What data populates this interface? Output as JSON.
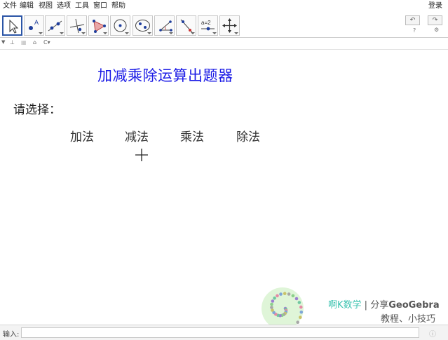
{
  "menu": {
    "items": [
      "文件",
      "编辑",
      "视图",
      "选项",
      "工具",
      "窗口",
      "帮助"
    ],
    "login": "登录"
  },
  "toolbar": {
    "tools": [
      {
        "icon": "move-arrow-icon",
        "active": true
      },
      {
        "icon": "point-icon",
        "label": "A"
      },
      {
        "icon": "line-icon"
      },
      {
        "icon": "perpendicular-line-icon"
      },
      {
        "icon": "polygon-icon"
      },
      {
        "icon": "circle-icon"
      },
      {
        "icon": "ellipse-icon"
      },
      {
        "icon": "angle-icon"
      },
      {
        "icon": "reflect-icon"
      },
      {
        "icon": "slider-icon",
        "label": "a=2"
      },
      {
        "icon": "move-view-icon"
      }
    ],
    "undo": "↶",
    "redo": "↷",
    "help_icon": "?",
    "settings_icon": "⚙"
  },
  "stylebar": {
    "axes_toggle": "⊥",
    "grid_toggle": "▦",
    "home": "⌂",
    "point_capture": "C▾"
  },
  "canvas": {
    "title": "加减乘除运算出题器",
    "prompt": "请选择：",
    "options": [
      "加法",
      "减法",
      "乘法",
      "除法"
    ]
  },
  "watermark": {
    "brand": "啊K数学",
    "separator": "|",
    "share": "分享",
    "product": "GeoGebra",
    "line2": "教程、小技巧"
  },
  "inputbar": {
    "label": "输入:",
    "value": "",
    "placeholder": ""
  },
  "colors": {
    "title": "#1c1ce6",
    "active_tool_border": "#2b55a6",
    "brand": "#3cc3b0"
  }
}
